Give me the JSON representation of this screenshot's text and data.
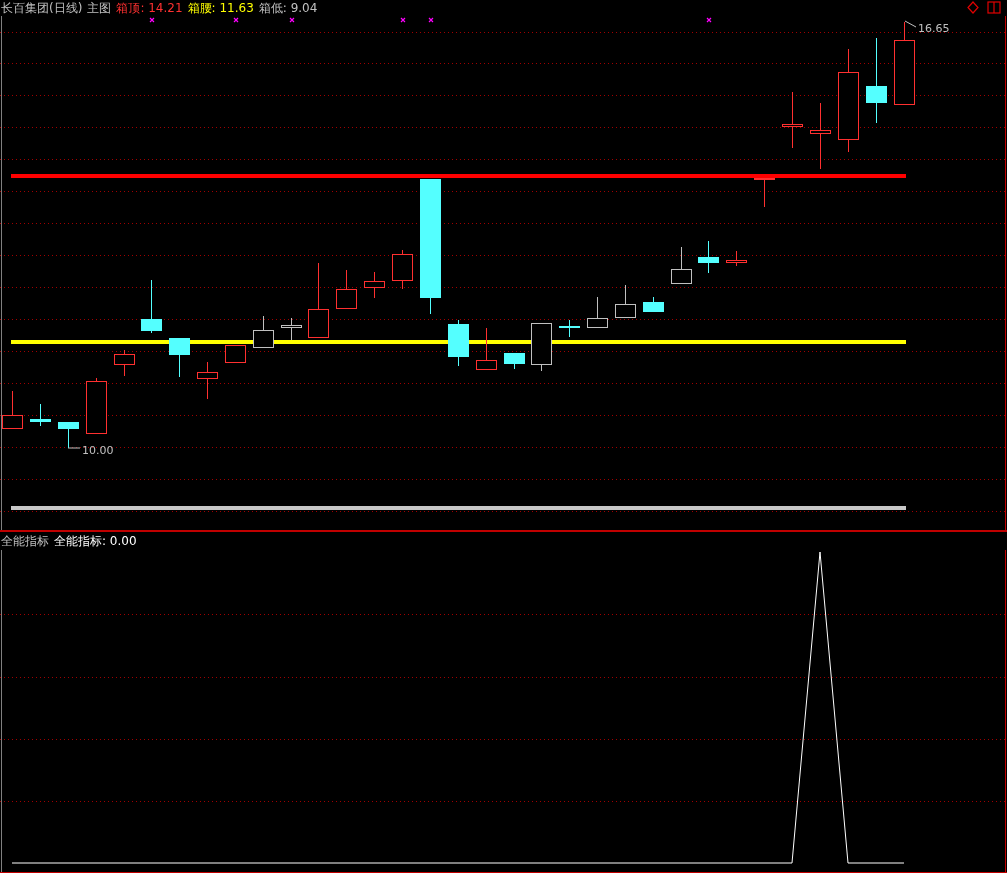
{
  "main_panel": {
    "title": "长百集团(日线)",
    "mode": "主图",
    "legend": [
      {
        "text": "箱顶: 14.21",
        "color": "#ff3030"
      },
      {
        "text": "箱腰: 11.63",
        "color": "#ffff00"
      },
      {
        "text": "箱低: 9.04",
        "color": "#c0c0c0"
      }
    ],
    "high_label": "16.65",
    "low_label": "10.00"
  },
  "indicator_panel": {
    "name": "全能指标",
    "reading": "全能指标: 0.00"
  }
}
